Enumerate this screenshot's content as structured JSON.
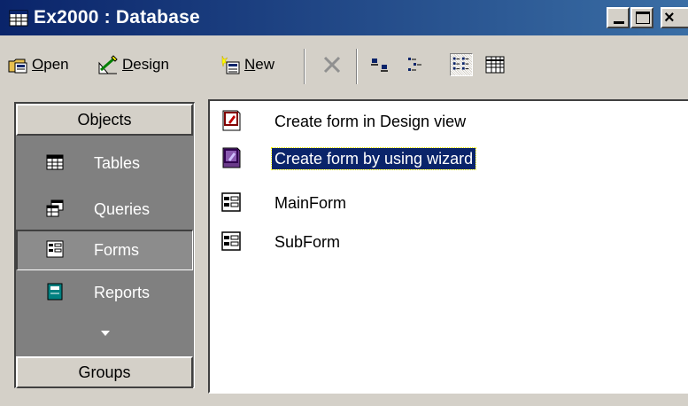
{
  "window": {
    "title": "Ex2000 : Database",
    "close_glyph": "×"
  },
  "toolbar": {
    "open_label": "Open",
    "open_underline": "O",
    "design_label": "Design",
    "design_underline": "D",
    "new_label": "New",
    "new_underline": "N"
  },
  "objects_bar": {
    "header": "Objects",
    "items": [
      {
        "label": "Tables",
        "icon": "table-icon"
      },
      {
        "label": "Queries",
        "icon": "query-icon"
      },
      {
        "label": "Forms",
        "icon": "form-icon",
        "selected": true
      },
      {
        "label": "Reports",
        "icon": "report-icon"
      }
    ],
    "groups_header": "Groups"
  },
  "list": {
    "items": [
      {
        "label": "Create form in Design view",
        "icon": "design-view-shortcut-icon"
      },
      {
        "label": "Create form by using wizard",
        "icon": "wizard-shortcut-icon",
        "selected": true
      },
      {
        "label": "MainForm",
        "icon": "form-icon"
      },
      {
        "label": "SubForm",
        "icon": "form-icon"
      }
    ]
  },
  "colors": {
    "titlebar_start": "#0a246a",
    "titlebar_end": "#3a6ea5",
    "face": "#d4d0c8",
    "objbar_bg": "#808080",
    "selection": "#0a246a"
  }
}
